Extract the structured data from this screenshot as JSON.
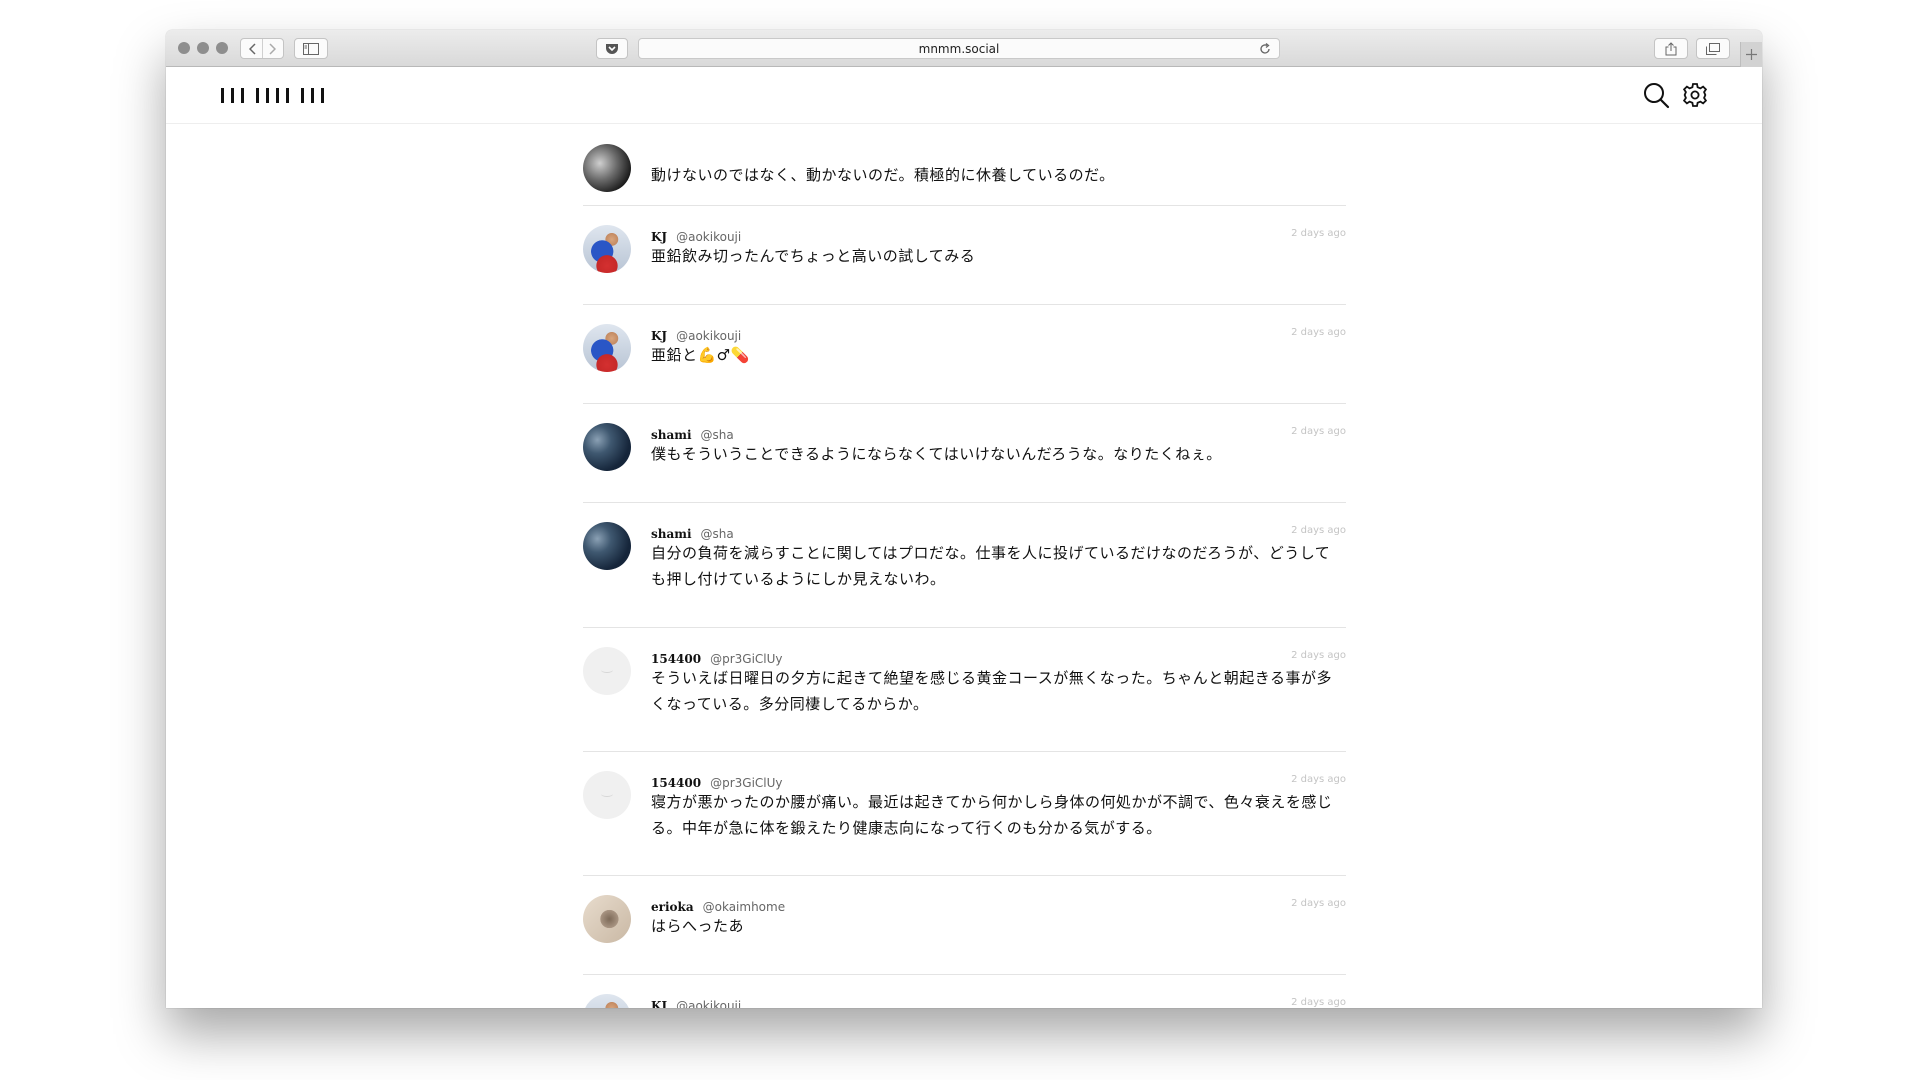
{
  "browser": {
    "url": "mnmm.social",
    "icons": [
      "back-icon",
      "forward-icon",
      "sidebar-icon",
      "pocket-icon",
      "reload-icon",
      "share-icon",
      "tabs-icon",
      "new-tab-icon"
    ]
  },
  "header": {
    "icons": [
      "search-icon",
      "gear-icon"
    ]
  },
  "colors": {
    "timestamp": "#c4c4c4",
    "divider": "#e4e4e4"
  },
  "posts": [
    {
      "name": "",
      "handle": "",
      "time": "",
      "body": "動けないのではなく、動かないのだ。積極的に休養しているのだ。",
      "avatar": "photo-bw"
    },
    {
      "name": "KJ",
      "handle": "@aokikouji",
      "time": "2 days ago",
      "body": "亜鉛飲み切ったんでちょっと高いの試してみる",
      "avatar": "superhero"
    },
    {
      "name": "KJ",
      "handle": "@aokikouji",
      "time": "2 days ago",
      "body": "亜鉛と💪♂💊",
      "avatar": "superhero"
    },
    {
      "name": "shami",
      "handle": "@sha",
      "time": "2 days ago",
      "body": "僕もそういうことできるようにならなくてはいけないんだろうな。なりたくねぇ。",
      "avatar": "sky"
    },
    {
      "name": "shami",
      "handle": "@sha",
      "time": "2 days ago",
      "body": "自分の負荷を減らすことに関してはプロだな。仕事を人に投げているだけなのだろうが、どうしても押し付けているようにしか見えないわ。",
      "avatar": "sky"
    },
    {
      "name": "154400",
      "handle": "@pr3GiClUy",
      "time": "2 days ago",
      "body": "そういえば日曜日の夕方に起きて絶望を感じる黄金コースが無くなった。ちゃんと朝起きる事が多くなっている。多分同棲してるからか。",
      "avatar": "default"
    },
    {
      "name": "154400",
      "handle": "@pr3GiClUy",
      "time": "2 days ago",
      "body": "寝方が悪かったのか腰が痛い。最近は起きてから何かしら身体の何処かが不調で、色々衰えを感じる。中年が急に体を鍛えたり健康志向になって行くのも分かる気がする。",
      "avatar": "default"
    },
    {
      "name": "erioka",
      "handle": "@okaimhome",
      "time": "2 days ago",
      "body": "はらへったあ",
      "avatar": "cat"
    },
    {
      "name": "KJ",
      "handle": "@aokikouji",
      "time": "2 days ago",
      "body": "💪♂💊",
      "avatar": "superhero"
    }
  ]
}
